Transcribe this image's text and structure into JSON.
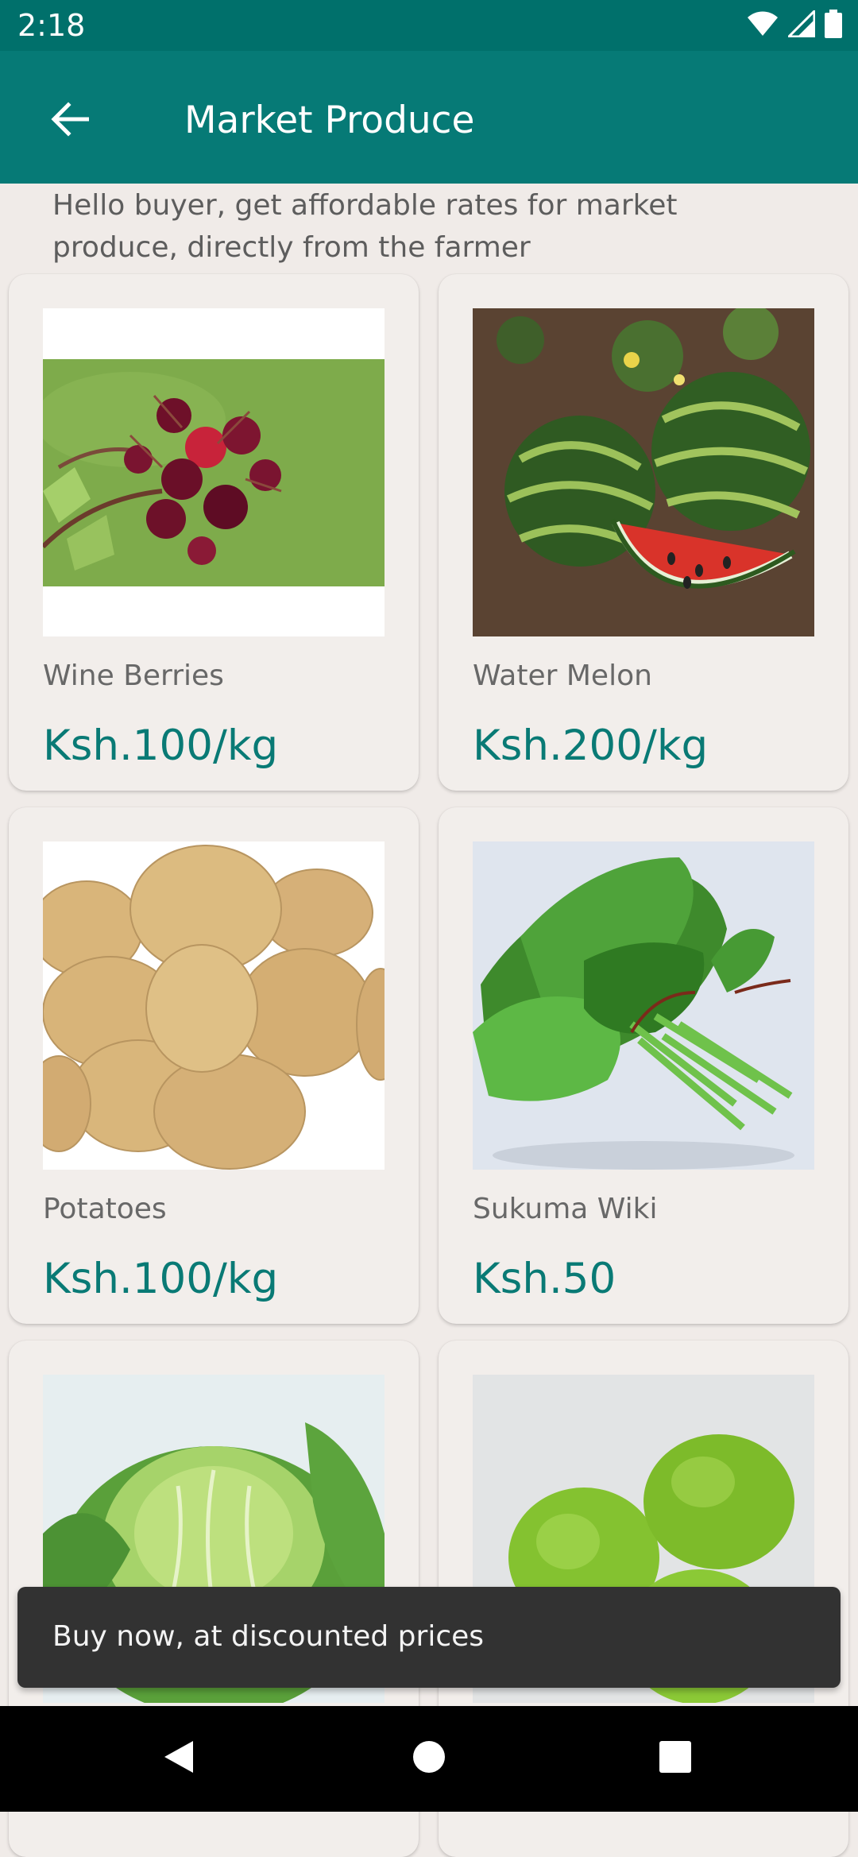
{
  "status_bar": {
    "time": "2:18",
    "icons": [
      "wifi-icon",
      "signal-icon",
      "battery-icon"
    ]
  },
  "app_bar": {
    "back_icon": "back-arrow-icon",
    "title": "Market Produce"
  },
  "intro_text": "Hello buyer, get affordable rates for market produce, directly from the farmer",
  "products": [
    {
      "name": "Wine Berries",
      "price": "Ksh.100/kg",
      "image": "wine-berries-image"
    },
    {
      "name": "Water Melon",
      "price": "Ksh.200/kg",
      "image": "water-melon-image"
    },
    {
      "name": "Potatoes",
      "price": "Ksh.100/kg",
      "image": "potatoes-image"
    },
    {
      "name": "Sukuma Wiki",
      "price": "Ksh.50",
      "image": "sukuma-wiki-image"
    },
    {
      "image": "cabbage-image"
    },
    {
      "image": "limes-image"
    }
  ],
  "snackbar": {
    "message": "Buy now, at discounted prices"
  },
  "nav_bar": {
    "icons": [
      "back-triangle-icon",
      "home-circle-icon",
      "recents-square-icon"
    ]
  },
  "colors": {
    "status_bar": "#00706b",
    "app_bar": "#067a76",
    "background": "#f0ebe8",
    "price_text": "#097a75",
    "snackbar": "#323232"
  }
}
